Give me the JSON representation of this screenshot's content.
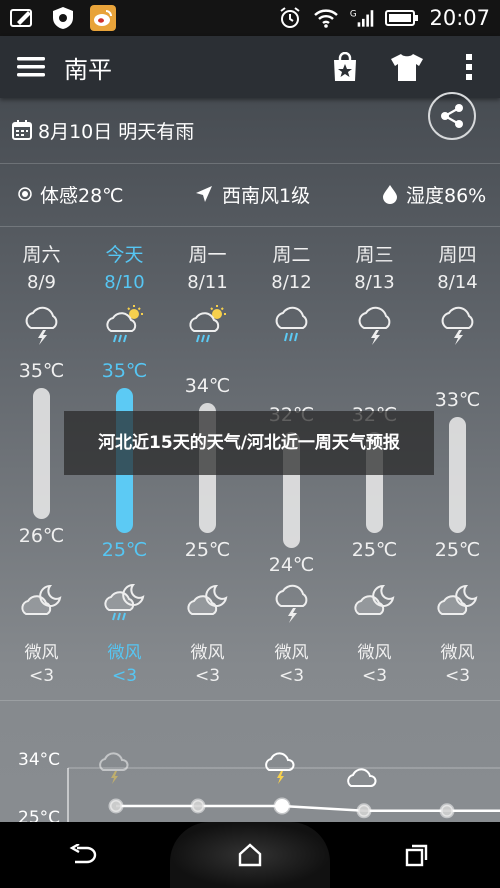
{
  "status_bar": {
    "time": "20:07"
  },
  "app_bar": {
    "city": "南平"
  },
  "date_line": "8月10日 明天有雨",
  "info": {
    "feels_like": "体感28℃",
    "wind": "西南风1级",
    "humidity": "湿度86%"
  },
  "forecast": [
    {
      "day": "周六",
      "date": "8/9",
      "high": "35℃",
      "low": "26℃",
      "high_val": 35,
      "low_val": 26,
      "day_icon": "cloud-thunder-icon",
      "night_icon": "moon-cloud-icon",
      "wind": "微风",
      "level": "<3",
      "today": false
    },
    {
      "day": "今天",
      "date": "8/10",
      "high": "35℃",
      "low": "25℃",
      "high_val": 35,
      "low_val": 25,
      "day_icon": "sun-cloud-rain-icon",
      "night_icon": "moon-cloud-rain-icon",
      "wind": "微风",
      "level": "<3",
      "today": true
    },
    {
      "day": "周一",
      "date": "8/11",
      "high": "34℃",
      "low": "25℃",
      "high_val": 34,
      "low_val": 25,
      "day_icon": "sun-cloud-rain-icon",
      "night_icon": "moon-cloud-icon",
      "wind": "微风",
      "level": "<3",
      "today": false
    },
    {
      "day": "周二",
      "date": "8/12",
      "high": "32℃",
      "low": "24℃",
      "high_val": 32,
      "low_val": 24,
      "day_icon": "cloud-rain-icon",
      "night_icon": "cloud-thunder-icon",
      "wind": "微风",
      "level": "<3",
      "today": false
    },
    {
      "day": "周三",
      "date": "8/13",
      "high": "32℃",
      "low": "25℃",
      "high_val": 32,
      "low_val": 25,
      "day_icon": "cloud-thunder-icon",
      "night_icon": "moon-cloud-icon",
      "wind": "微风",
      "level": "<3",
      "today": false
    },
    {
      "day": "周四",
      "date": "8/14",
      "high": "33℃",
      "low": "25℃",
      "high_val": 33,
      "low_val": 25,
      "day_icon": "cloud-thunder-icon",
      "night_icon": "moon-cloud-icon",
      "wind": "微风",
      "level": "<3",
      "today": false
    }
  ],
  "overlay": {
    "caption": "河北近15天的天气/河北近一周天气预报"
  },
  "hourly": {
    "labels": [
      "34°C",
      "25°C"
    ],
    "temps": [
      26,
      26,
      26,
      25.6,
      25.6,
      25.6
    ]
  }
}
